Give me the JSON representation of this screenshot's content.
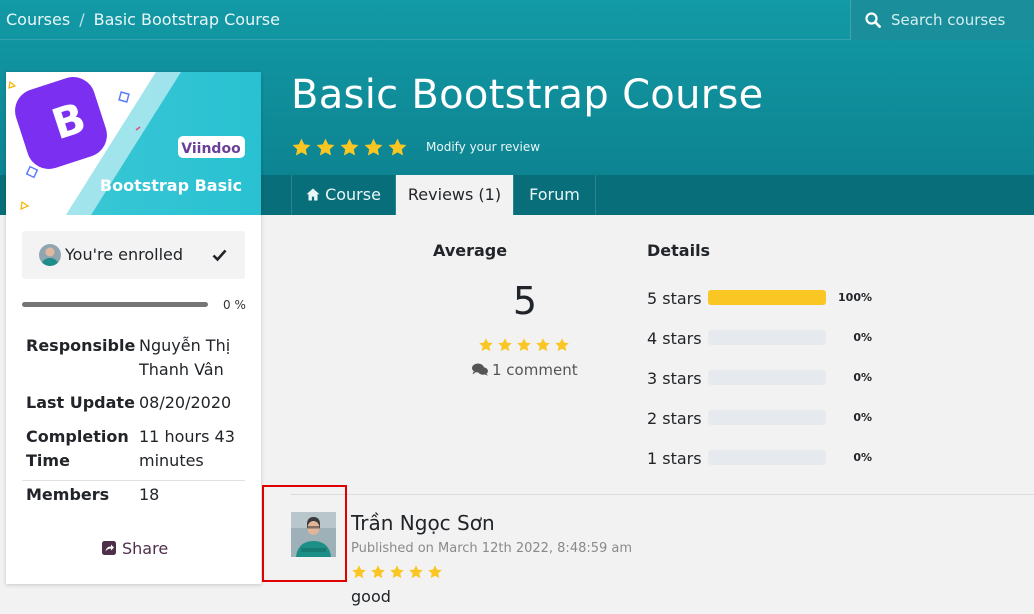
{
  "breadcrumb": {
    "root": "Courses",
    "separator": "/",
    "current": "Basic Bootstrap Course"
  },
  "search": {
    "placeholder": "Search courses"
  },
  "course": {
    "title": "Basic Bootstrap Course",
    "rating": 5,
    "modify_review_label": "Modify your review"
  },
  "tabs": [
    {
      "label": "Course",
      "icon": "home-icon"
    },
    {
      "label": "Reviews (1)",
      "active": true
    },
    {
      "label": "Forum"
    }
  ],
  "thumbnail": {
    "brand": "Viindoo",
    "caption": "Bootstrap Basic",
    "logo_letter": "B"
  },
  "sidebar": {
    "enrolled_label": "You're enrolled",
    "progress_value": 0,
    "progress_label": "0 %",
    "info": [
      {
        "key": "Responsible",
        "value": "Nguyễn Thị Thanh Vân"
      },
      {
        "key": "Last Update",
        "value": "08/20/2020"
      },
      {
        "key": "Completion Time",
        "value": "11 hours 43 minutes"
      },
      {
        "key": "Members",
        "value": "18"
      }
    ],
    "share_label": "Share"
  },
  "reviews_summary": {
    "average_heading": "Average",
    "details_heading": "Details",
    "average_value": "5",
    "comment_count_label": "1 comment",
    "distribution": [
      {
        "label": "5 stars",
        "percent_label": "100%",
        "value": 100
      },
      {
        "label": "4 stars",
        "percent_label": "0%",
        "value": 0
      },
      {
        "label": "3 stars",
        "percent_label": "0%",
        "value": 0
      },
      {
        "label": "2 stars",
        "percent_label": "0%",
        "value": 0
      },
      {
        "label": "1 stars",
        "percent_label": "0%",
        "value": 0
      }
    ]
  },
  "review": {
    "author": "Trần Ngọc Sơn",
    "published": "Published on March 12th 2022, 8:48:59 am",
    "rating": 5,
    "text": "good"
  },
  "colors": {
    "hero": "#129aa6",
    "tabs_band": "#086f7a",
    "star": "#f9c624",
    "highlight_box": "#e00000",
    "share": "#4d2f4a"
  }
}
